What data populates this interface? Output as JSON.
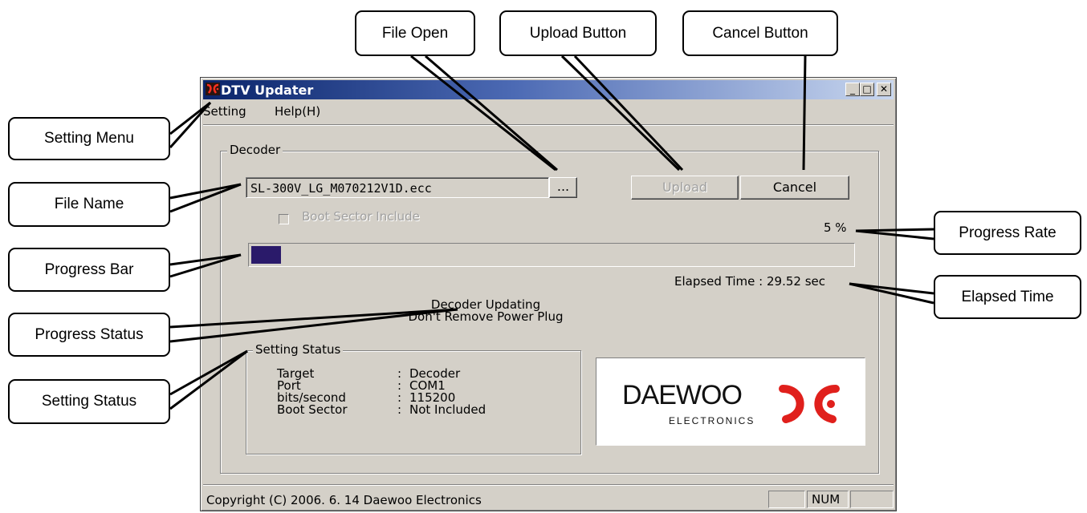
{
  "callouts": {
    "file_open": "File Open",
    "upload_button": "Upload Button",
    "cancel_button": "Cancel Button",
    "setting_menu": "Setting Menu",
    "file_name": "File Name",
    "progress_rate": "Progress Rate",
    "progress_bar": "Progress Bar",
    "elapsed_time": "Elapsed Time",
    "progress_status": "Progress Status",
    "setting_status": "Setting Status"
  },
  "window": {
    "title": "DTV Updater",
    "controls": {
      "minimize": "_",
      "maximize": "□",
      "close": "✕"
    }
  },
  "menu": {
    "setting": "Setting",
    "help": "Help(H)"
  },
  "decoder": {
    "group_label": "Decoder",
    "file_name": "SL-300V_LG_M070212V1D.ecc",
    "browse_label": "...",
    "upload_label": "Upload",
    "cancel_label": "Cancel",
    "boot_sector_label": "Boot Sector Include",
    "boot_sector_checked": false,
    "progress_text": "5 %",
    "progress_value": 0.05,
    "elapsed_text": "Elapsed Time : 29.52 sec",
    "status_line1": "Decoder Updating",
    "status_line2": "Don't Remove Power Plug"
  },
  "setting_status": {
    "group_label": "Setting Status",
    "rows": [
      {
        "key": "Target",
        "value": "Decoder"
      },
      {
        "key": "Port",
        "value": "COM1"
      },
      {
        "key": "bits/second",
        "value": "115200"
      },
      {
        "key": "Boot Sector",
        "value": "Not Included"
      }
    ]
  },
  "logo": {
    "brand": "DAEWOO",
    "sub": "ELECTRONICS"
  },
  "statusbar": {
    "copyright": "Copyright (C) 2006. 6. 14 Daewoo Electronics",
    "num": "NUM"
  },
  "colors": {
    "window_bg": "#d4d0c8",
    "title_start": "#0a246a",
    "progress_fill": "#2a1a6a",
    "logo_red": "#e0201c"
  }
}
